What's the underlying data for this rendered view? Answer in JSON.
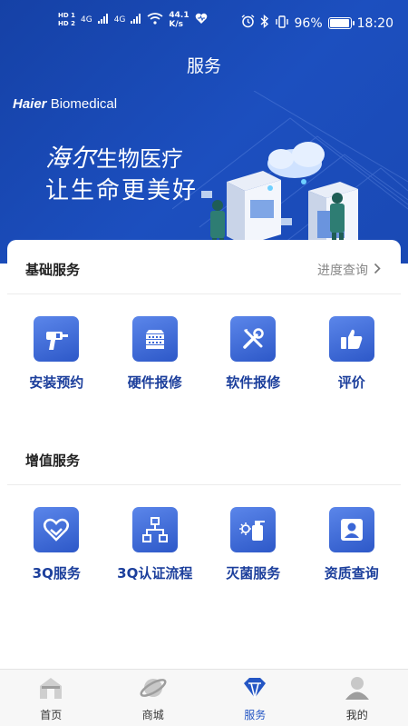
{
  "status_bar": {
    "hd1": "HD 1",
    "hd2": "HD 2",
    "net1": "4G",
    "net2": "4G",
    "speed": "44.1",
    "speed_unit": "K/s",
    "battery": "96%",
    "battery_level": 0.96,
    "time": "18:20"
  },
  "header": {
    "title": "服务"
  },
  "banner": {
    "brand_bold": "Haier",
    "brand_rest": "Biomedical",
    "slogan_script": "海尔",
    "slogan_line1": "生物医疗",
    "slogan_line2": "让生命更美好"
  },
  "basic_services": {
    "title": "基础服务",
    "link": "进度查询",
    "items": [
      {
        "label": "安装预约",
        "icon": "drill-icon"
      },
      {
        "label": "硬件报修",
        "icon": "hardware-icon"
      },
      {
        "label": "软件报修",
        "icon": "tools-icon"
      },
      {
        "label": "评价",
        "icon": "thumbs-up-icon"
      }
    ]
  },
  "value_services": {
    "title": "增值服务",
    "items": [
      {
        "label": "3Q服务",
        "icon": "heart-hands-icon"
      },
      {
        "label": "3Q认证流程",
        "icon": "flowchart-icon"
      },
      {
        "label": "灭菌服务",
        "icon": "spray-icon"
      },
      {
        "label": "资质查询",
        "icon": "person-icon"
      }
    ]
  },
  "tabbar": {
    "items": [
      {
        "label": "首页",
        "icon": "home-icon"
      },
      {
        "label": "商城",
        "icon": "planet-icon"
      },
      {
        "label": "服务",
        "icon": "diamond-icon",
        "active": true
      },
      {
        "label": "我的",
        "icon": "user-icon"
      }
    ]
  },
  "colors": {
    "banner_blue": "#1c4fbf",
    "icon_blue": "#3a66d6",
    "label_blue": "#1c3f9c",
    "active_tab": "#2456c4"
  }
}
